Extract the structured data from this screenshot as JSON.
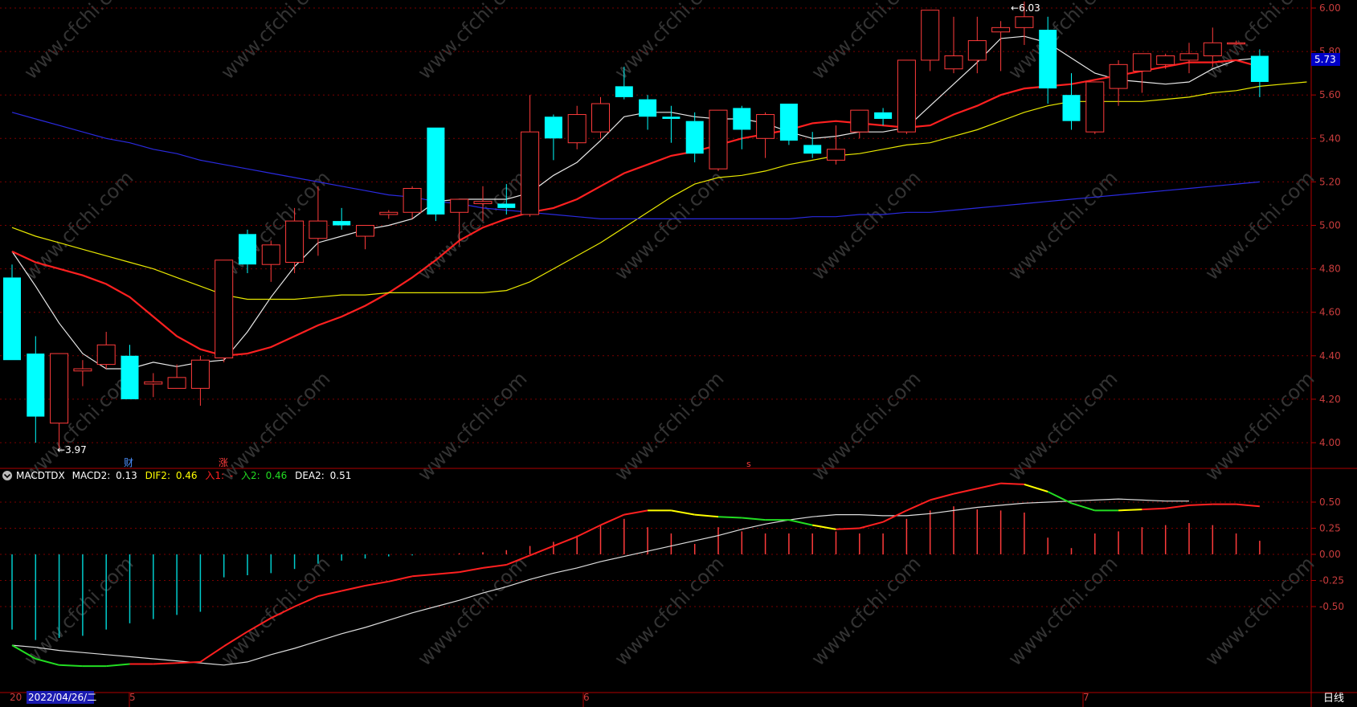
{
  "colors": {
    "background": "#000000",
    "up_candle": "#ff3b3b",
    "down_candle": "#00ffff",
    "grid": "#7a0000",
    "axis_text": "#c83c3c",
    "ma1": "#e8e8e8",
    "ma2": "#ff2020",
    "ma3": "#e8e800",
    "ma4": "#2a2ae0",
    "dif": "#ffff00",
    "red": "#ff2020",
    "green": "#22dd22",
    "dea": "#dddddd",
    "price_tag_bg": "#0000c8"
  },
  "price_axis": {
    "ticks": [
      "6.00",
      "5.80",
      "5.60",
      "5.40",
      "5.20",
      "5.00",
      "4.80",
      "4.60",
      "4.40",
      "4.20",
      "4.00"
    ],
    "current_price": "5.73"
  },
  "price_labels": {
    "low": "3.97",
    "high": "6.03"
  },
  "event_markers": {
    "cai": "财",
    "zhang": "涨",
    "s": "s"
  },
  "macd_header": {
    "name": "MACDTDX",
    "macd2_label": "MACD2:",
    "macd2_value": "0.13",
    "dif2_label": "DIF2:",
    "dif2_value": "0.46",
    "ru1_label": "入1:",
    "ru1_value": "-",
    "ru2_label": "入2:",
    "ru2_value": "0.46",
    "dea2_label": "DEA2:",
    "dea2_value": "0.51"
  },
  "macd_axis": {
    "ticks": [
      "0.50",
      "0.25",
      "0.00",
      "-0.25",
      "-0.50"
    ]
  },
  "date_axis": {
    "prefix": "20",
    "cursor_date": "2022/04/26/二",
    "months": [
      "5",
      "6",
      "7"
    ],
    "period": "日线"
  },
  "watermark": "www.cfchi.com",
  "chart_data": [
    {
      "type": "candlestick",
      "ylim": [
        3.9,
        6.03
      ],
      "candles": [
        {
          "o": 4.76,
          "h": 4.82,
          "l": 4.38,
          "c": 4.38
        },
        {
          "o": 4.41,
          "h": 4.49,
          "l": 4.0,
          "c": 4.12
        },
        {
          "o": 4.09,
          "h": 4.41,
          "l": 3.97,
          "c": 4.41
        },
        {
          "o": 4.33,
          "h": 4.38,
          "l": 4.26,
          "c": 4.34
        },
        {
          "o": 4.36,
          "h": 4.51,
          "l": 4.34,
          "c": 4.45
        },
        {
          "o": 4.4,
          "h": 4.45,
          "l": 4.2,
          "c": 4.2
        },
        {
          "o": 4.27,
          "h": 4.32,
          "l": 4.21,
          "c": 4.28
        },
        {
          "o": 4.25,
          "h": 4.36,
          "l": 4.25,
          "c": 4.3
        },
        {
          "o": 4.25,
          "h": 4.4,
          "l": 4.17,
          "c": 4.38
        },
        {
          "o": 4.39,
          "h": 4.84,
          "l": 4.37,
          "c": 4.84
        },
        {
          "o": 4.96,
          "h": 4.98,
          "l": 4.78,
          "c": 4.82
        },
        {
          "o": 4.82,
          "h": 4.93,
          "l": 4.74,
          "c": 4.91
        },
        {
          "o": 4.83,
          "h": 5.08,
          "l": 4.78,
          "c": 5.02
        },
        {
          "o": 4.94,
          "h": 5.18,
          "l": 4.86,
          "c": 5.02
        },
        {
          "o": 5.02,
          "h": 5.08,
          "l": 4.98,
          "c": 5.0
        },
        {
          "o": 4.95,
          "h": 5.0,
          "l": 4.89,
          "c": 5.0
        },
        {
          "o": 5.05,
          "h": 5.07,
          "l": 5.03,
          "c": 5.06
        },
        {
          "o": 5.06,
          "h": 5.18,
          "l": 5.03,
          "c": 5.17
        },
        {
          "o": 5.45,
          "h": 5.45,
          "l": 5.02,
          "c": 5.05
        },
        {
          "o": 5.06,
          "h": 5.12,
          "l": 4.91,
          "c": 5.12
        },
        {
          "o": 5.1,
          "h": 5.18,
          "l": 5.02,
          "c": 5.11
        },
        {
          "o": 5.1,
          "h": 5.19,
          "l": 5.05,
          "c": 5.08
        },
        {
          "o": 5.05,
          "h": 5.6,
          "l": 5.04,
          "c": 5.43
        },
        {
          "o": 5.5,
          "h": 5.51,
          "l": 5.3,
          "c": 5.4
        },
        {
          "o": 5.38,
          "h": 5.55,
          "l": 5.35,
          "c": 5.51
        },
        {
          "o": 5.43,
          "h": 5.59,
          "l": 5.4,
          "c": 5.56
        },
        {
          "o": 5.64,
          "h": 5.73,
          "l": 5.58,
          "c": 5.59
        },
        {
          "o": 5.58,
          "h": 5.6,
          "l": 5.44,
          "c": 5.5
        },
        {
          "o": 5.5,
          "h": 5.55,
          "l": 5.38,
          "c": 5.49
        },
        {
          "o": 5.48,
          "h": 5.52,
          "l": 5.29,
          "c": 5.33
        },
        {
          "o": 5.26,
          "h": 5.53,
          "l": 5.25,
          "c": 5.53
        },
        {
          "o": 5.54,
          "h": 5.55,
          "l": 5.35,
          "c": 5.44
        },
        {
          "o": 5.4,
          "h": 5.52,
          "l": 5.31,
          "c": 5.51
        },
        {
          "o": 5.56,
          "h": 5.56,
          "l": 5.37,
          "c": 5.39
        },
        {
          "o": 5.37,
          "h": 5.43,
          "l": 5.31,
          "c": 5.33
        },
        {
          "o": 5.3,
          "h": 5.46,
          "l": 5.28,
          "c": 5.35
        },
        {
          "o": 5.43,
          "h": 5.53,
          "l": 5.4,
          "c": 5.53
        },
        {
          "o": 5.52,
          "h": 5.54,
          "l": 5.46,
          "c": 5.49
        },
        {
          "o": 5.43,
          "h": 5.66,
          "l": 5.42,
          "c": 5.76
        },
        {
          "o": 5.76,
          "h": 5.9,
          "l": 5.71,
          "c": 5.99
        },
        {
          "o": 5.72,
          "h": 5.96,
          "l": 5.7,
          "c": 5.78
        },
        {
          "o": 5.76,
          "h": 5.96,
          "l": 5.7,
          "c": 5.85
        },
        {
          "o": 5.89,
          "h": 5.94,
          "l": 5.71,
          "c": 5.91
        },
        {
          "o": 5.91,
          "h": 6.03,
          "l": 5.83,
          "c": 5.96
        },
        {
          "o": 5.9,
          "h": 5.96,
          "l": 5.56,
          "c": 5.63
        },
        {
          "o": 5.6,
          "h": 5.7,
          "l": 5.44,
          "c": 5.48
        },
        {
          "o": 5.43,
          "h": 5.66,
          "l": 5.42,
          "c": 5.66
        },
        {
          "o": 5.63,
          "h": 5.76,
          "l": 5.55,
          "c": 5.74
        },
        {
          "o": 5.71,
          "h": 5.79,
          "l": 5.61,
          "c": 5.79
        },
        {
          "o": 5.74,
          "h": 5.79,
          "l": 5.72,
          "c": 5.78
        },
        {
          "o": 5.76,
          "h": 5.84,
          "l": 5.7,
          "c": 5.79
        },
        {
          "o": 5.78,
          "h": 5.91,
          "l": 5.73,
          "c": 5.84
        },
        {
          "o": 5.84,
          "h": 5.85,
          "l": 5.83,
          "c": 5.84
        },
        {
          "o": 5.78,
          "h": 5.81,
          "l": 5.59,
          "c": 5.66
        }
      ],
      "moving_averages": [
        {
          "color_key": "ma1",
          "values": [
            4.88,
            4.72,
            4.55,
            4.41,
            4.34,
            4.34,
            4.37,
            4.35,
            4.37,
            4.38,
            4.51,
            4.67,
            4.81,
            4.92,
            4.95,
            4.98,
            5.0,
            5.03,
            5.11,
            5.12,
            5.12,
            5.12,
            5.15,
            5.23,
            5.29,
            5.39,
            5.5,
            5.52,
            5.52,
            5.5,
            5.49,
            5.49,
            5.47,
            5.43,
            5.4,
            5.41,
            5.43,
            5.43,
            5.45,
            5.55,
            5.65,
            5.75,
            5.86,
            5.87,
            5.84,
            5.77,
            5.7,
            5.67,
            5.66,
            5.65,
            5.66,
            5.72,
            5.76,
            5.77
          ]
        },
        {
          "color_key": "ma2",
          "values": [
            4.88,
            4.83,
            4.8,
            4.77,
            4.73,
            4.67,
            4.58,
            4.49,
            4.43,
            4.4,
            4.41,
            4.44,
            4.49,
            4.54,
            4.58,
            4.63,
            4.69,
            4.76,
            4.84,
            4.93,
            4.99,
            5.03,
            5.06,
            5.08,
            5.12,
            5.18,
            5.24,
            5.28,
            5.32,
            5.34,
            5.37,
            5.4,
            5.42,
            5.44,
            5.47,
            5.48,
            5.47,
            5.46,
            5.45,
            5.46,
            5.51,
            5.55,
            5.6,
            5.63,
            5.64,
            5.65,
            5.67,
            5.69,
            5.71,
            5.73,
            5.75,
            5.75,
            5.76,
            5.73
          ]
        },
        {
          "color_key": "ma3",
          "values": [
            4.99,
            4.95,
            4.92,
            4.89,
            4.86,
            4.83,
            4.8,
            4.76,
            4.72,
            4.68,
            4.66,
            4.66,
            4.66,
            4.67,
            4.68,
            4.68,
            4.69,
            4.69,
            4.69,
            4.69,
            4.69,
            4.7,
            4.74,
            4.8,
            4.86,
            4.92,
            4.99,
            5.06,
            5.13,
            5.19,
            5.22,
            5.23,
            5.25,
            5.28,
            5.3,
            5.32,
            5.33,
            5.35,
            5.37,
            5.38,
            5.41,
            5.44,
            5.48,
            5.52,
            5.55,
            5.57,
            5.57,
            5.57,
            5.57,
            5.58,
            5.59,
            5.61,
            5.62,
            5.64,
            5.65,
            5.66
          ]
        },
        {
          "color_key": "ma4",
          "values": [
            5.52,
            5.49,
            5.46,
            5.43,
            5.4,
            5.38,
            5.35,
            5.33,
            5.3,
            5.28,
            5.26,
            5.24,
            5.22,
            5.2,
            5.18,
            5.16,
            5.14,
            5.13,
            5.11,
            5.1,
            5.08,
            5.07,
            5.06,
            5.05,
            5.04,
            5.03,
            5.03,
            5.03,
            5.03,
            5.03,
            5.03,
            5.03,
            5.03,
            5.03,
            5.04,
            5.04,
            5.05,
            5.05,
            5.06,
            5.06,
            5.07,
            5.08,
            5.09,
            5.1,
            5.11,
            5.12,
            5.13,
            5.14,
            5.15,
            5.16,
            5.17,
            5.18,
            5.19,
            5.2
          ]
        }
      ]
    },
    {
      "type": "bar+line",
      "ylim": [
        -1.3,
        0.85
      ],
      "macd_hist": [
        -0.72,
        -0.82,
        -0.8,
        -0.78,
        -0.72,
        -0.66,
        -0.62,
        -0.58,
        -0.55,
        -0.22,
        -0.2,
        -0.18,
        -0.14,
        -0.09,
        -0.06,
        -0.04,
        -0.02,
        -0.01,
        0.0,
        0.01,
        0.02,
        0.04,
        0.08,
        0.12,
        0.18,
        0.28,
        0.34,
        0.26,
        0.2,
        0.1,
        0.26,
        0.22,
        0.2,
        0.2,
        0.2,
        0.22,
        0.2,
        0.2,
        0.34,
        0.42,
        0.46,
        0.43,
        0.42,
        0.4,
        0.16,
        0.06,
        0.2,
        0.22,
        0.26,
        0.28,
        0.3,
        0.28,
        0.2,
        0.13
      ],
      "dif": [
        -0.87,
        -1.0,
        -1.06,
        -1.07,
        -1.07,
        -1.05,
        -1.05,
        -1.04,
        -1.03,
        -0.88,
        -0.74,
        -0.61,
        -0.5,
        -0.4,
        -0.35,
        -0.3,
        -0.26,
        -0.21,
        -0.19,
        -0.17,
        -0.13,
        -0.1,
        -0.01,
        0.08,
        0.17,
        0.28,
        0.38,
        0.42,
        0.42,
        0.38,
        0.36,
        0.35,
        0.33,
        0.33,
        0.28,
        0.24,
        0.25,
        0.31,
        0.42,
        0.52,
        0.58,
        0.63,
        0.68,
        0.67,
        0.6,
        0.49,
        0.42,
        0.42,
        0.43,
        0.44,
        0.47,
        0.48,
        0.48,
        0.46
      ],
      "dea": [
        -0.87,
        -0.89,
        -0.92,
        -0.94,
        -0.96,
        -0.98,
        -1.0,
        -1.02,
        -1.04,
        -1.06,
        -1.03,
        -0.96,
        -0.9,
        -0.83,
        -0.76,
        -0.7,
        -0.63,
        -0.56,
        -0.5,
        -0.44,
        -0.37,
        -0.31,
        -0.24,
        -0.18,
        -0.13,
        -0.07,
        -0.02,
        0.03,
        0.08,
        0.13,
        0.18,
        0.24,
        0.29,
        0.33,
        0.36,
        0.38,
        0.38,
        0.37,
        0.37,
        0.39,
        0.42,
        0.45,
        0.47,
        0.49,
        0.5,
        0.51,
        0.52,
        0.53,
        0.52,
        0.51,
        0.51
      ],
      "dif_segment_colors": [
        "green",
        "green",
        "green",
        "green",
        "green",
        "red",
        "red",
        "red",
        "red",
        "red",
        "red",
        "red",
        "red",
        "red",
        "red",
        "red",
        "red",
        "red",
        "red",
        "red",
        "red",
        "red",
        "red",
        "red",
        "red",
        "red",
        "red",
        "dif",
        "dif",
        "dif",
        "green",
        "green",
        "green",
        "green",
        "dif",
        "red",
        "red",
        "red",
        "red",
        "red",
        "red",
        "red",
        "red",
        "dif",
        "green",
        "green",
        "green",
        "dif",
        "red",
        "red",
        "red",
        "red",
        "red",
        "dif"
      ]
    }
  ]
}
